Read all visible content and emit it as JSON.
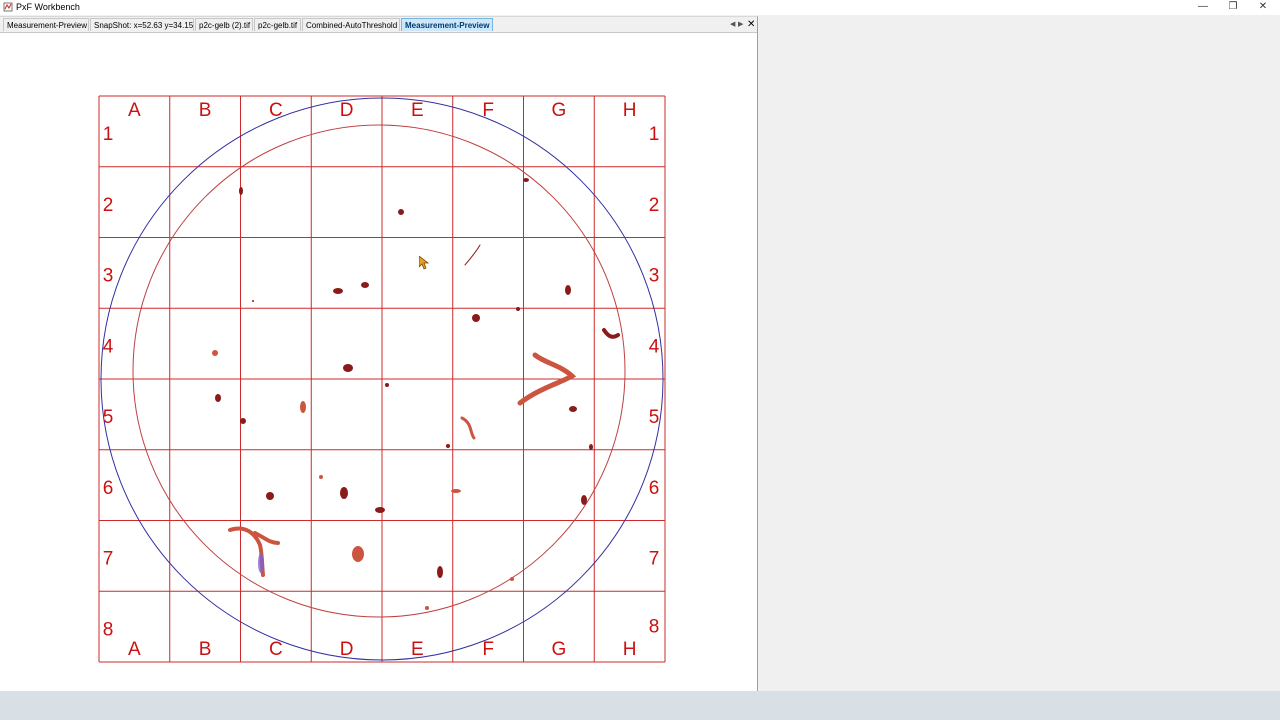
{
  "app": {
    "title": "PxF Workbench"
  },
  "window_controls": {
    "minimize": "—",
    "restore": "❐",
    "close": "✕"
  },
  "tabs": [
    {
      "label": "Measurement-Preview",
      "active": false
    },
    {
      "label": "SnapShot: x=52.63 y=34.15",
      "active": false
    },
    {
      "label": "p2c-gelb (2).tif",
      "active": false
    },
    {
      "label": "p2c-gelb.tif",
      "active": false
    },
    {
      "label": "Combined-AutoThreshold",
      "active": false
    },
    {
      "label": "Measurement-Preview",
      "active": true
    }
  ],
  "tab_controls": {
    "prev": "◀",
    "next": "▶",
    "close": "✕"
  },
  "grid": {
    "columns": [
      "A",
      "B",
      "C",
      "D",
      "E",
      "F",
      "G",
      "H"
    ],
    "rows": [
      "1",
      "2",
      "3",
      "4",
      "5",
      "6",
      "7",
      "8"
    ],
    "line_color": "#cc2a2a",
    "label_color": "#cc1010"
  },
  "circles": {
    "outer_color": "#3030a0",
    "inner_color": "#c04040"
  },
  "particle_colors": {
    "dark": "#8b1a1a",
    "light": "#cc5540",
    "highlight": "#8060d0"
  }
}
